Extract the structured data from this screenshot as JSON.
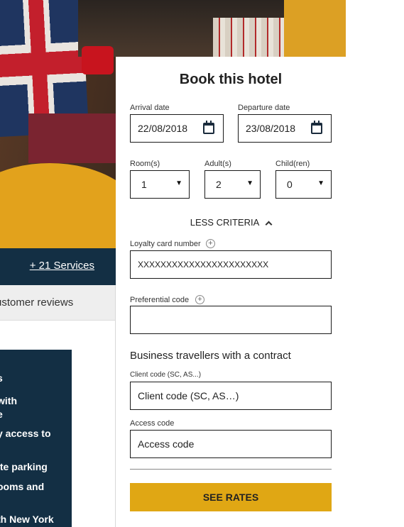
{
  "left": {
    "services_link": "+ 21 Services",
    "reviews_tab": "ustomer reviews",
    "info_lines": [
      "s",
      "with",
      "e",
      "y access to",
      "ite parking",
      "ooms and",
      "th New York"
    ]
  },
  "booking": {
    "title": "Book this hotel",
    "arrival": {
      "label": "Arrival date",
      "value": "22/08/2018"
    },
    "departure": {
      "label": "Departure date",
      "value": "23/08/2018"
    },
    "rooms": {
      "label": "Room(s)",
      "value": "1"
    },
    "adults": {
      "label": "Adult(s)",
      "value": "2"
    },
    "children": {
      "label": "Child(ren)",
      "value": "0"
    },
    "less_criteria": "LESS CRITERIA",
    "loyalty": {
      "label": "Loyalty card number",
      "value": "XXXXXXXXXXXXXXXXXXXXXXX"
    },
    "preferential": {
      "label": "Preferential code",
      "value": ""
    },
    "business_title": "Business travellers with a contract",
    "client_code": {
      "label": "Client code (SC, AS...)",
      "placeholder": "Client code (SC, AS…)"
    },
    "access_code": {
      "label": "Access code",
      "placeholder": "Access code"
    },
    "submit": "SEE RATES"
  },
  "icons": {
    "calendar": "calendar-icon",
    "dropdown": "caret-down-icon",
    "plus": "plus-circle-icon",
    "chevron": "chevron-up-icon"
  },
  "colors": {
    "navy": "#132f44",
    "accent": "#e0a714"
  }
}
